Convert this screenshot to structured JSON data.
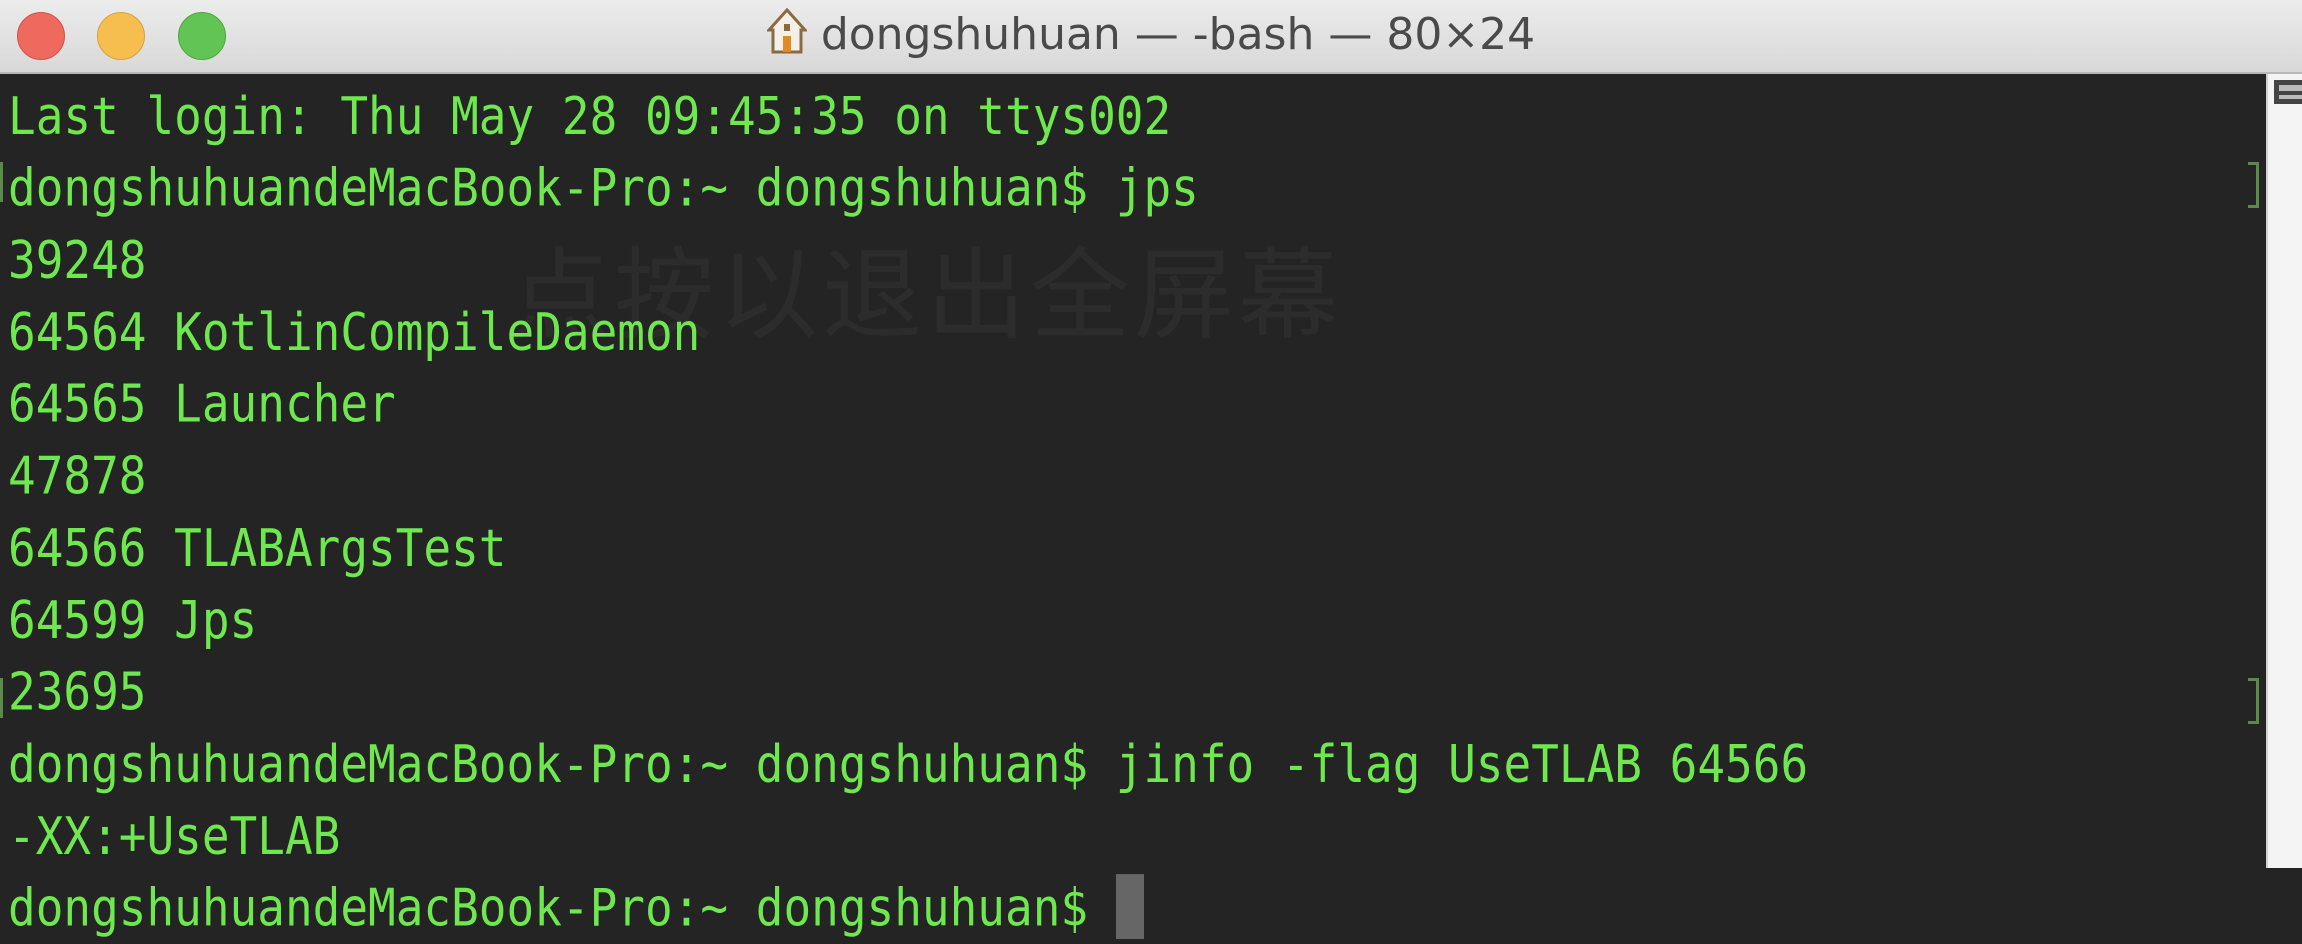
{
  "window": {
    "title": "dongshuhuan — -bash — 80×24",
    "title_icon": "home-icon"
  },
  "watermark": "点按以退出全屏幕",
  "terminal": {
    "lines": [
      "Last login: Thu May 28 09:45:35 on ttys002",
      "dongshuhuandeMacBook-Pro:~ dongshuhuan$ jps",
      "39248",
      "64564 KotlinCompileDaemon",
      "64565 Launcher",
      "47878",
      "64566 TLABArgsTest",
      "64599 Jps",
      "23695",
      "dongshuhuandeMacBook-Pro:~ dongshuhuan$ jinfo -flag UseTLAB 64566",
      "-XX:+UseTLAB",
      "dongshuhuandeMacBook-Pro:~ dongshuhuan$ "
    ]
  },
  "colors": {
    "text": "#6ee84e",
    "background": "#242424"
  }
}
